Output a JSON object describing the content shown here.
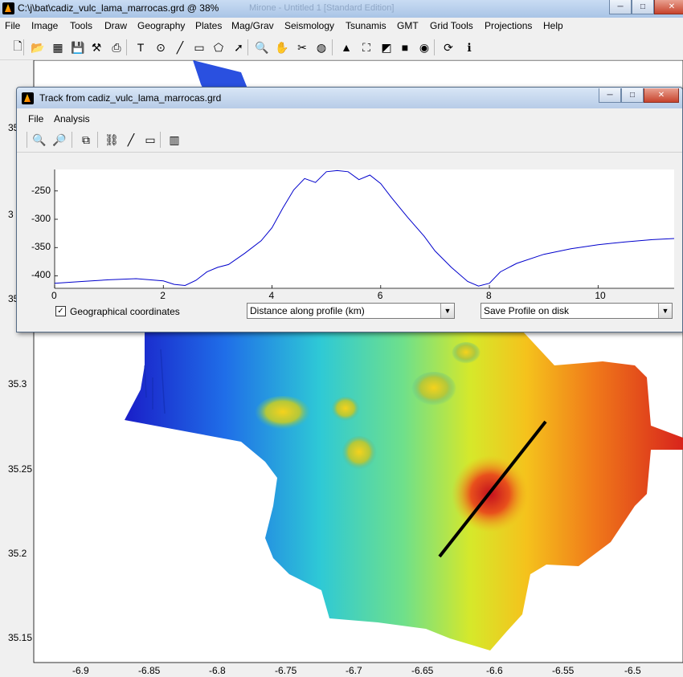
{
  "main_window": {
    "title": "C:\\j\\bat\\cadiz_vulc_lama_marrocas.grd  @  38%",
    "faded_title": "Mirone - Untitled 1 [Standard Edition]",
    "window_buttons": {
      "minimize": "─",
      "maximize": "□",
      "close": "✕"
    }
  },
  "main_menu": [
    "File",
    "Image",
    "Tools",
    "Draw",
    "Geography",
    "Plates",
    "Mag/Grav",
    "Seismology",
    "Tsunamis",
    "GMT",
    "Grid Tools",
    "Projections",
    "Help"
  ],
  "main_toolbar": [
    {
      "name": "new-file-icon",
      "glyph": "🗋"
    },
    {
      "name": "open-folder-icon",
      "glyph": "📂"
    },
    {
      "name": "open-image-icon",
      "glyph": "▦"
    },
    {
      "name": "save-icon",
      "glyph": "💾"
    },
    {
      "name": "tools-icon",
      "glyph": "⚒"
    },
    {
      "name": "print-icon",
      "glyph": "⎙"
    },
    {
      "name": "text-icon",
      "glyph": "T"
    },
    {
      "name": "circle-icon",
      "glyph": "⊙"
    },
    {
      "name": "line-icon",
      "glyph": "╱"
    },
    {
      "name": "rectangle-icon",
      "glyph": "▭"
    },
    {
      "name": "polygon-icon",
      "glyph": "⬠"
    },
    {
      "name": "arrow-icon",
      "glyph": "➚"
    },
    {
      "name": "zoom-icon",
      "glyph": "🔍"
    },
    {
      "name": "pan-hand-icon",
      "glyph": "✋"
    },
    {
      "name": "scissors-icon",
      "glyph": "✂"
    },
    {
      "name": "color-palette-icon",
      "glyph": "◍"
    },
    {
      "name": "shading-icon",
      "glyph": "▲"
    },
    {
      "name": "binoculars-icon",
      "glyph": "⛶"
    },
    {
      "name": "3d-view-icon",
      "glyph": "◩"
    },
    {
      "name": "dark-image-icon",
      "glyph": "■"
    },
    {
      "name": "globe-icon",
      "glyph": "◉"
    },
    {
      "name": "refresh-icon",
      "glyph": "⟳"
    },
    {
      "name": "info-icon",
      "glyph": "ℹ"
    }
  ],
  "map": {
    "y_ticks": [
      "35.3",
      "35.25",
      "35.2",
      "35.15"
    ],
    "x_ticks": [
      "-6.9",
      "-6.85",
      "-6.8",
      "-6.75",
      "-6.7",
      "-6.65",
      "-6.6",
      "-6.55",
      "-6.5"
    ],
    "hidden_y_ticks": [
      "35",
      "3",
      "35"
    ],
    "colors": {
      "deep": "#1e2cc8",
      "mid": "#2ec9d6",
      "shallow": "#f5e21c",
      "peak": "#d8141c",
      "track": "#000000"
    }
  },
  "track_window": {
    "title": "Track from cadiz_vulc_lama_marrocas.grd",
    "menu": [
      "File",
      "Analysis"
    ],
    "toolbar": [
      {
        "name": "zoom-in-icon",
        "glyph": "🔍"
      },
      {
        "name": "zoom-reset-icon",
        "glyph": "🔎"
      },
      {
        "name": "copy-icon",
        "glyph": "⧉"
      },
      {
        "name": "link-icon",
        "glyph": "⛓"
      },
      {
        "name": "draw-line-icon",
        "glyph": "╱"
      },
      {
        "name": "rectangle-icon",
        "glyph": "▭"
      },
      {
        "name": "barcode-icon",
        "glyph": "▥"
      }
    ],
    "geo_checkbox": {
      "label": "Geographical coordinates",
      "checked": true,
      "mark": "✓"
    },
    "distance_dropdown": {
      "value": "Distance along profile (km)",
      "arrow": "▼"
    },
    "save_dropdown": {
      "value": "Save Profile on disk",
      "arrow": "▼"
    }
  },
  "chart_data": {
    "type": "line",
    "title": "",
    "xlabel": "",
    "ylabel": "",
    "xlim": [
      0,
      11.4
    ],
    "ylim": [
      -422,
      -212
    ],
    "x_ticks": [
      0,
      2,
      4,
      6,
      8,
      10
    ],
    "y_ticks": [
      -250,
      -300,
      -350,
      -400
    ],
    "grid": false,
    "series": [
      {
        "color": "#0000cc",
        "x": [
          0,
          0.5,
          1,
          1.5,
          2,
          2.2,
          2.4,
          2.6,
          2.8,
          3,
          3.2,
          3.5,
          3.8,
          4,
          4.2,
          4.4,
          4.6,
          4.8,
          5,
          5.2,
          5.4,
          5.6,
          5.8,
          6,
          6.2,
          6.5,
          6.8,
          7,
          7.3,
          7.6,
          7.8,
          8,
          8.2,
          8.5,
          9,
          9.5,
          10,
          10.5,
          11,
          11.4
        ],
        "y": [
          -413,
          -410,
          -407,
          -405,
          -409,
          -415,
          -417,
          -408,
          -393,
          -385,
          -380,
          -360,
          -338,
          -315,
          -280,
          -248,
          -228,
          -235,
          -216,
          -214,
          -216,
          -230,
          -222,
          -237,
          -262,
          -297,
          -330,
          -356,
          -385,
          -410,
          -418,
          -413,
          -393,
          -378,
          -362,
          -352,
          -345,
          -340,
          -336,
          -334
        ]
      }
    ]
  }
}
